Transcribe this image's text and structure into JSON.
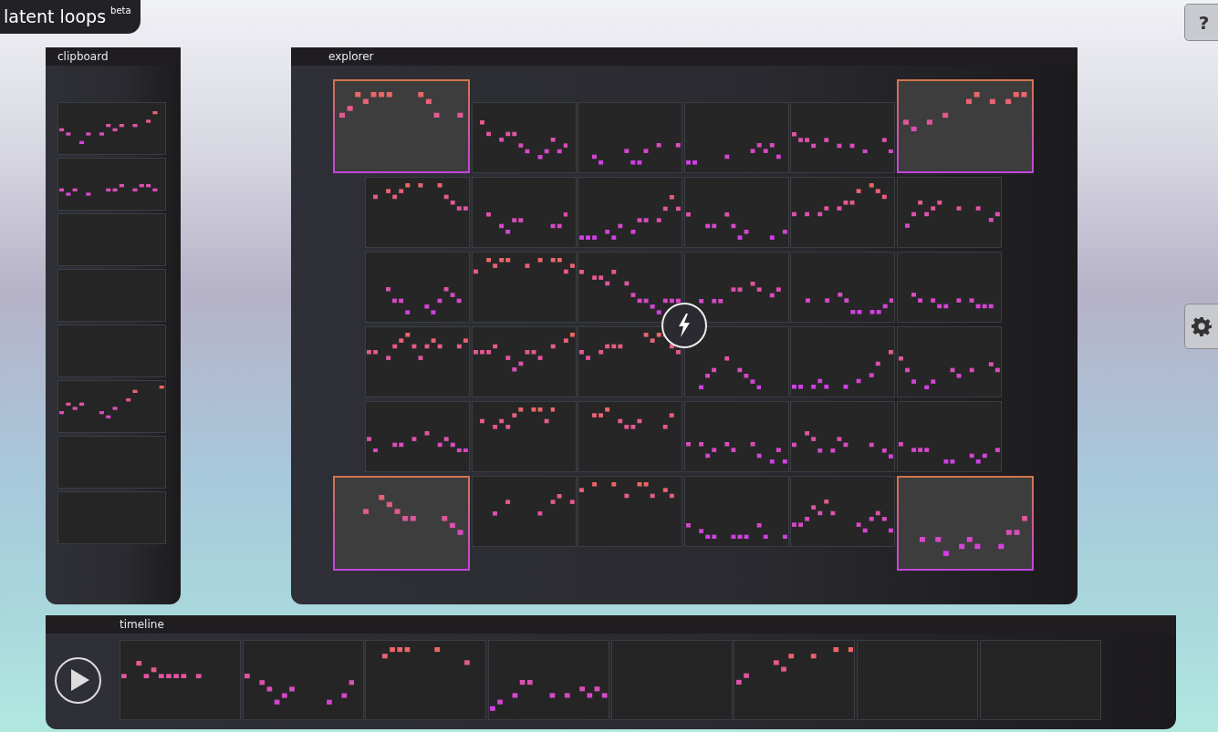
{
  "logo": {
    "title": "latent loops",
    "badge": "beta"
  },
  "help_button": {
    "label": "?"
  },
  "clipboard": {
    "title": "clipboard",
    "slots": [
      {
        "filled": true
      },
      {
        "filled": true
      },
      {
        "filled": false
      },
      {
        "filled": false
      },
      {
        "filled": false
      },
      {
        "filled": true
      },
      {
        "filled": false
      },
      {
        "filled": false
      }
    ]
  },
  "explorer": {
    "title": "explorer",
    "tiles": [
      {
        "kind": "corner"
      },
      {
        "kind": "blend"
      },
      {
        "kind": "blend"
      },
      {
        "kind": "blend"
      },
      {
        "kind": "blend"
      },
      {
        "kind": "corner"
      },
      {
        "kind": "blend"
      },
      {
        "kind": "blend"
      },
      {
        "kind": "blend"
      },
      {
        "kind": "blend"
      },
      {
        "kind": "blend"
      },
      {
        "kind": "blend"
      },
      {
        "kind": "blend"
      },
      {
        "kind": "blend"
      },
      {
        "kind": "blend"
      },
      {
        "kind": "blend"
      },
      {
        "kind": "blend"
      },
      {
        "kind": "blend"
      },
      {
        "kind": "blend"
      },
      {
        "kind": "blend"
      },
      {
        "kind": "blend"
      },
      {
        "kind": "blend"
      },
      {
        "kind": "blend"
      },
      {
        "kind": "blend"
      },
      {
        "kind": "blend"
      },
      {
        "kind": "blend"
      },
      {
        "kind": "blend"
      },
      {
        "kind": "blend"
      },
      {
        "kind": "blend"
      },
      {
        "kind": "blend"
      },
      {
        "kind": "corner"
      },
      {
        "kind": "blend"
      },
      {
        "kind": "blend"
      },
      {
        "kind": "blend"
      },
      {
        "kind": "blend"
      },
      {
        "kind": "corner"
      }
    ]
  },
  "timeline": {
    "title": "timeline",
    "slots": [
      {
        "filled": true
      },
      {
        "filled": true
      },
      {
        "filled": true
      },
      {
        "filled": true
      },
      {
        "filled": false
      },
      {
        "filled": true
      },
      {
        "filled": false
      },
      {
        "filled": false
      }
    ]
  }
}
